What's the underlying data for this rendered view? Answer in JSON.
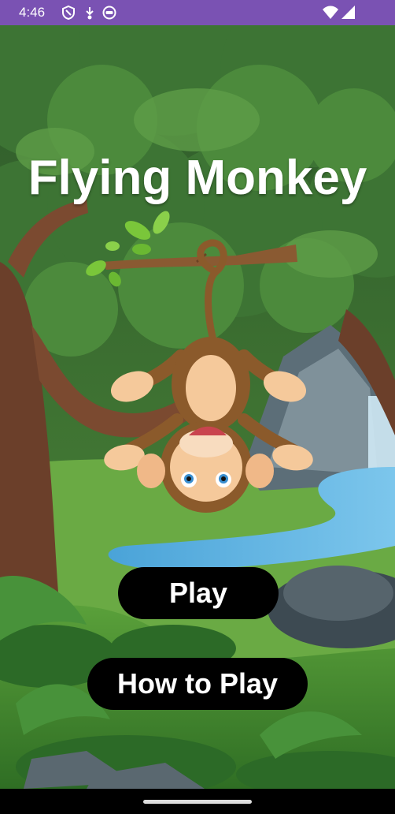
{
  "status_bar": {
    "time": "4:46",
    "left_icons": [
      "shield-icon",
      "download-icon",
      "face-icon"
    ],
    "right_icons": [
      "wifi-icon",
      "cellular-signal-icon"
    ],
    "background_color": "#7a52b3"
  },
  "game": {
    "title": "Flying Monkey",
    "buttons": {
      "play_label": "Play",
      "how_to_play_label": "How to Play"
    }
  },
  "colors": {
    "button_bg": "#000000",
    "button_text": "#ffffff",
    "title_text": "#ffffff"
  }
}
